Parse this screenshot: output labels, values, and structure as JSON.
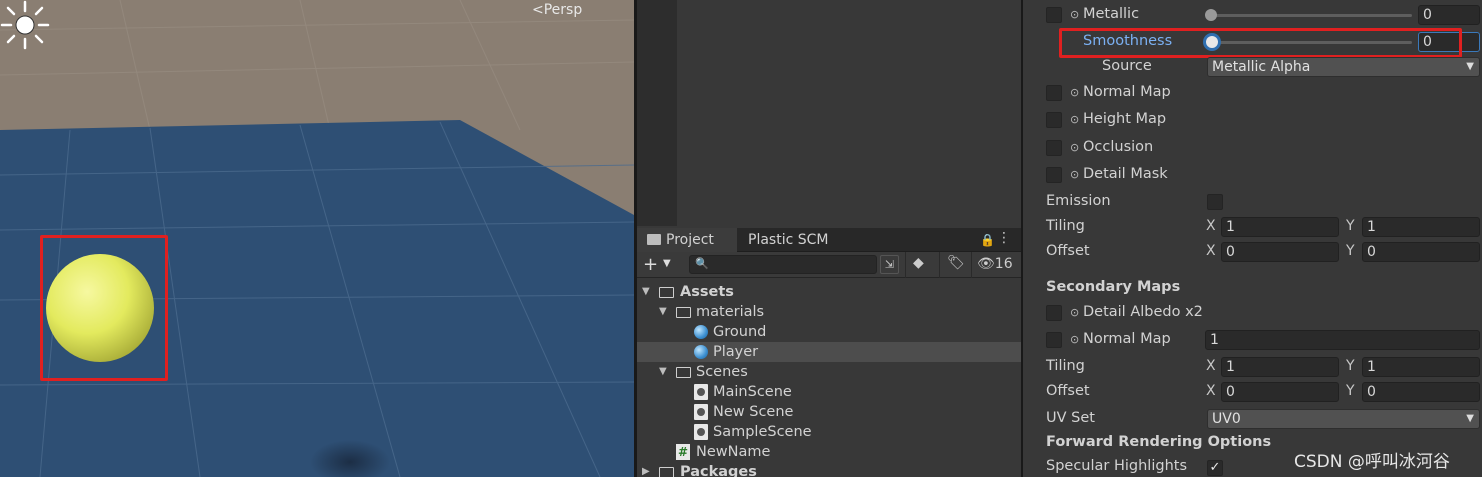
{
  "scene": {
    "projection_label": "<Persp",
    "sun_icon": "sun-light-icon",
    "colors": {
      "sky": "#8a7e72",
      "ground": "#2e4f74",
      "sphere": "#e8ee70"
    }
  },
  "project": {
    "tabs": [
      {
        "label": "Project",
        "icon": "folder-icon"
      },
      {
        "label": "Plastic SCM"
      }
    ],
    "toolbar": {
      "add_label": "+",
      "hidden_count": "16"
    },
    "tree": [
      {
        "label": "Assets",
        "kind": "folder",
        "depth": 0,
        "expanded": true
      },
      {
        "label": "materials",
        "kind": "folder",
        "depth": 1,
        "expanded": true
      },
      {
        "label": "Ground",
        "kind": "material",
        "depth": 2
      },
      {
        "label": "Player",
        "kind": "material",
        "depth": 2,
        "selected": true
      },
      {
        "label": "Scenes",
        "kind": "folder",
        "depth": 1,
        "expanded": true
      },
      {
        "label": "MainScene",
        "kind": "scene",
        "depth": 2
      },
      {
        "label": "New Scene",
        "kind": "scene",
        "depth": 2
      },
      {
        "label": "SampleScene",
        "kind": "scene",
        "depth": 2
      },
      {
        "label": "NewName",
        "kind": "script",
        "depth": 1
      },
      {
        "label": "Packages",
        "kind": "folder",
        "depth": 0,
        "expanded": false
      }
    ]
  },
  "inspector": {
    "metallic": {
      "label": "Metallic",
      "value": "0",
      "slider_fraction": 0
    },
    "smoothness": {
      "label": "Smoothness",
      "value": "0",
      "slider_fraction": 0
    },
    "source": {
      "label": "Source",
      "value": "Metallic Alpha"
    },
    "maps": [
      "Normal Map",
      "Height Map",
      "Occlusion",
      "Detail Mask"
    ],
    "emission": {
      "label": "Emission"
    },
    "tiling": {
      "label": "Tiling",
      "x_label": "X",
      "x": "1",
      "y_label": "Y",
      "y": "1"
    },
    "offset": {
      "label": "Offset",
      "x_label": "X",
      "x": "0",
      "y_label": "Y",
      "y": "0"
    },
    "secondary": {
      "header": "Secondary Maps",
      "detail_albedo": "Detail Albedo x2",
      "normal_map": {
        "label": "Normal Map",
        "value": "1"
      },
      "tiling": {
        "label": "Tiling",
        "x_label": "X",
        "x": "1",
        "y_label": "Y",
        "y": "1"
      },
      "offset": {
        "label": "Offset",
        "x_label": "X",
        "x": "0",
        "y_label": "Y",
        "y": "0"
      },
      "uv_set": {
        "label": "UV Set",
        "value": "UV0"
      }
    },
    "forward": {
      "header": "Forward Rendering Options",
      "specular": "Specular Highlights",
      "specular_checked": true
    }
  },
  "watermark": "CSDN @呼叫冰河谷"
}
